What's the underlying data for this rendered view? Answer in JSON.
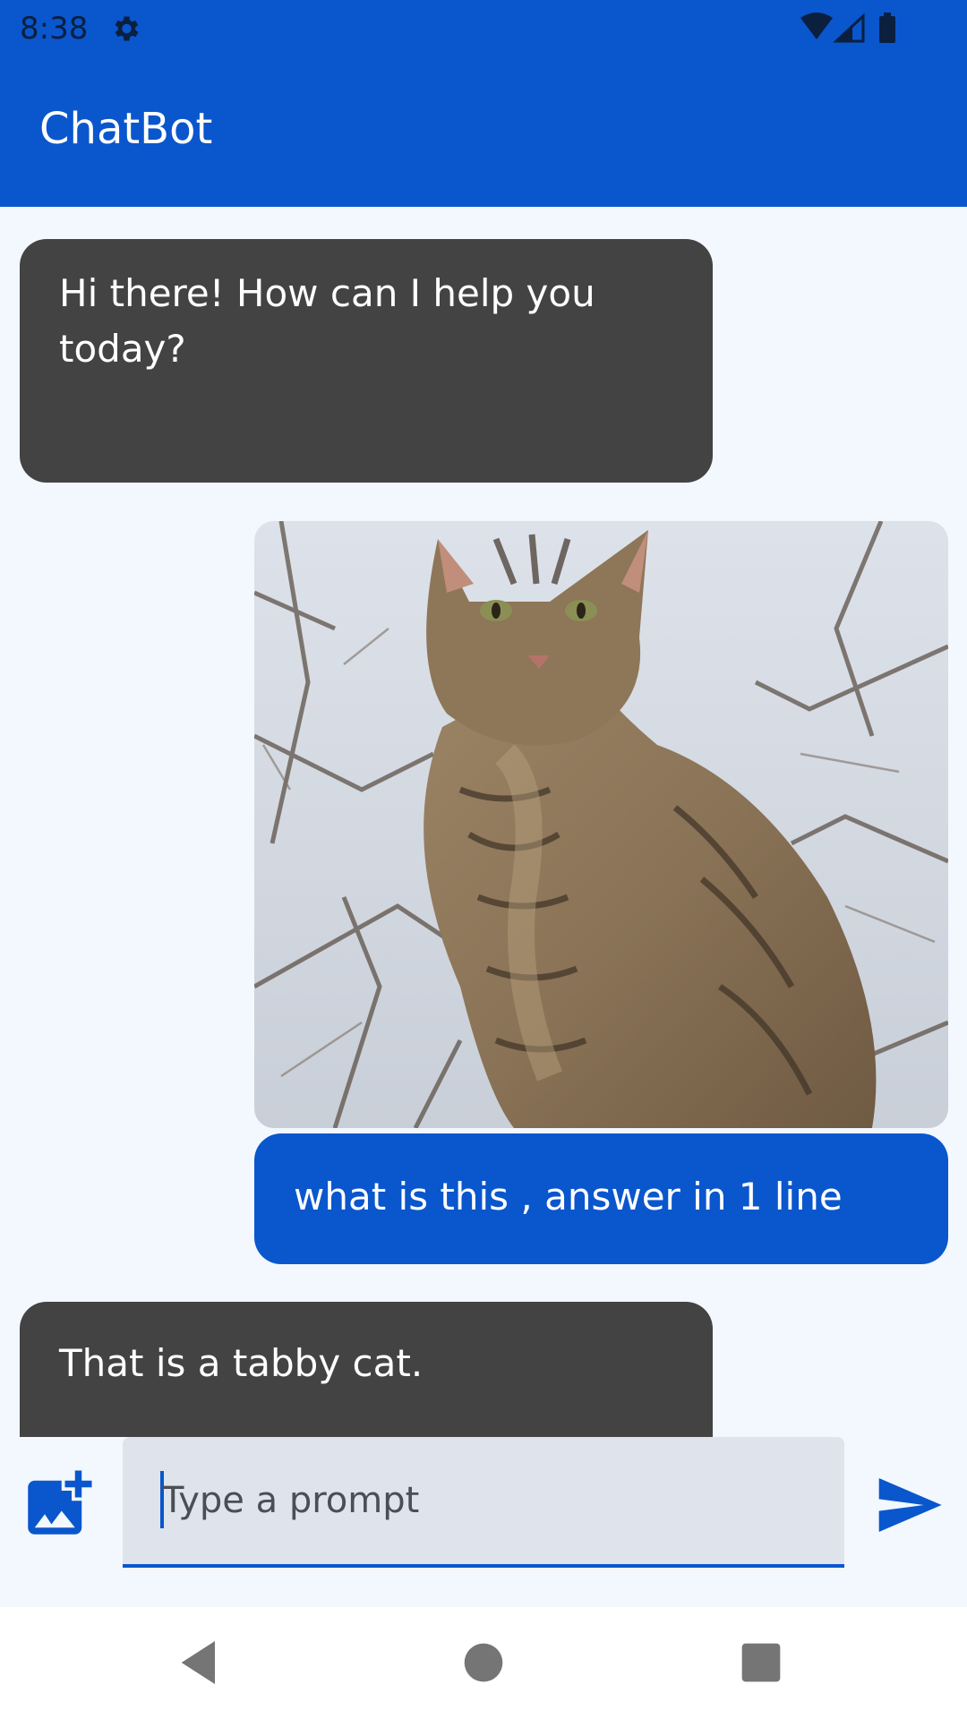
{
  "status_bar": {
    "time": "8:38"
  },
  "app_bar": {
    "title": "ChatBot"
  },
  "messages": [
    {
      "role": "bot",
      "text": "Hi there! How can I help you today?"
    },
    {
      "role": "user",
      "attachment": "cat photo"
    },
    {
      "role": "user",
      "text": "what is this , answer in 1 line"
    },
    {
      "role": "bot",
      "text": "That is a tabby cat."
    }
  ],
  "composer": {
    "placeholder": "Type a prompt",
    "value": ""
  },
  "colors": {
    "primary": "#0a56cd",
    "bot_bubble": "#434343",
    "background": "#f2f8fe",
    "input_bg": "#dfe4ec"
  },
  "icons": {
    "status": [
      "gear-icon",
      "wifi-icon",
      "signal-icon",
      "battery-icon"
    ],
    "composer": [
      "add-photo-icon",
      "send-icon"
    ],
    "nav": [
      "back-icon",
      "home-icon",
      "recents-icon"
    ]
  }
}
